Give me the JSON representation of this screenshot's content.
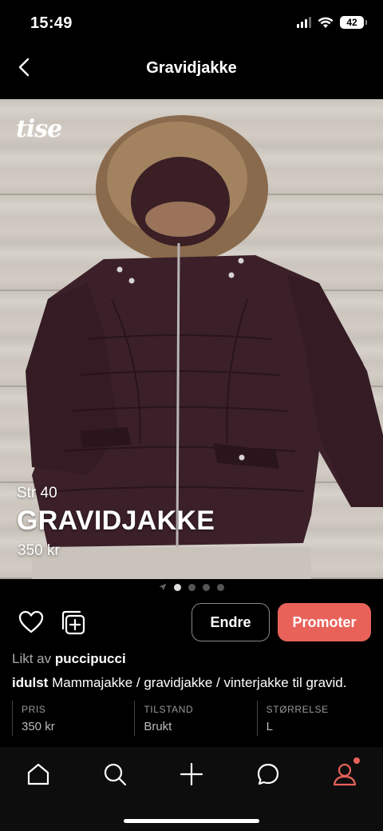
{
  "status_bar": {
    "time": "15:49",
    "battery": "42"
  },
  "nav": {
    "title": "Gravidjakke",
    "back_icon": "chevron-left-icon"
  },
  "photo": {
    "logo": "tise",
    "size_text": "Str 40",
    "title_text": "GRAVIDJAKKE",
    "price_text": "350 kr",
    "page_count": 4,
    "active_page": 1
  },
  "actions": {
    "like_icon": "heart-icon",
    "collection_icon": "add-to-collection-icon",
    "edit_label": "Endre",
    "promote_label": "Promoter",
    "promote_color": "#e8625a"
  },
  "liked_by": {
    "prefix": "Likt av",
    "user": "puccipucci"
  },
  "description": {
    "user": "idulst",
    "text": "Mammajakke / gravidjakke / vinterjakke til gravid."
  },
  "specs": [
    {
      "label": "PRIS",
      "value": "350 kr"
    },
    {
      "label": "TILSTAND",
      "value": "Brukt"
    },
    {
      "label": "STØRRELSE",
      "value": "L"
    }
  ],
  "tab_bar": {
    "items": [
      "home-icon",
      "search-icon",
      "plus-icon",
      "chat-icon",
      "profile-icon"
    ],
    "notification_color": "#e8625a"
  }
}
